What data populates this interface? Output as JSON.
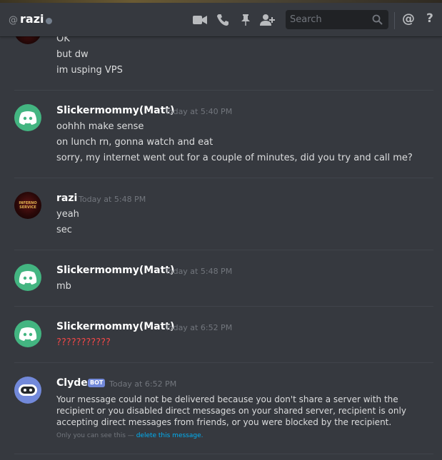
{
  "header": {
    "at_symbol": "@",
    "channel_name": "razi",
    "search_placeholder": "Search",
    "mention_icon": "@",
    "help_icon": "?"
  },
  "icons": {
    "video": "video-call-icon",
    "phone": "voice-call-icon",
    "pin": "pin-icon",
    "add_friend": "add-member-icon",
    "search": "search-icon"
  },
  "colors": {
    "background": "#36393f",
    "discord_green": "#43b581",
    "blurple": "#7289da",
    "error_red": "#f04747",
    "link_blue": "#00b0f4"
  },
  "messages": {
    "previous": {
      "lines": [
        "OK",
        "but dw",
        "im usping VPS"
      ]
    },
    "m1": {
      "author": "Slickermommy(Matt)",
      "timestamp": "Today at 5:40 PM",
      "lines": [
        "oohhh make sense",
        "on lunch rn, gonna watch and eat",
        "sorry, my internet went out for a couple of minutes, did you try and call me?"
      ]
    },
    "m2": {
      "author": "razi",
      "timestamp": "Today at 5:48 PM",
      "avatar_text": "INFERNO SERVICE",
      "lines": [
        "yeah",
        "sec"
      ]
    },
    "m3": {
      "author": "Slickermommy(Matt)",
      "timestamp": "Today at 5:48 PM",
      "lines": [
        "mb"
      ]
    },
    "m4": {
      "author": "Slickermommy(Matt)",
      "timestamp": "Today at 6:52 PM",
      "lines": [
        "???????????"
      ]
    },
    "m5": {
      "author": "Clyde",
      "bot_tag": "BOT",
      "timestamp": "Today at 6:52 PM",
      "text": "Your message could not be delivered because you don't share a server with the recipient or you disabled direct messages on your shared server, recipient is only accepting direct messages from friends, or you were blocked by the recipient.",
      "only_you_prefix": "Only you can see this —",
      "delete_link": "delete this message."
    }
  }
}
